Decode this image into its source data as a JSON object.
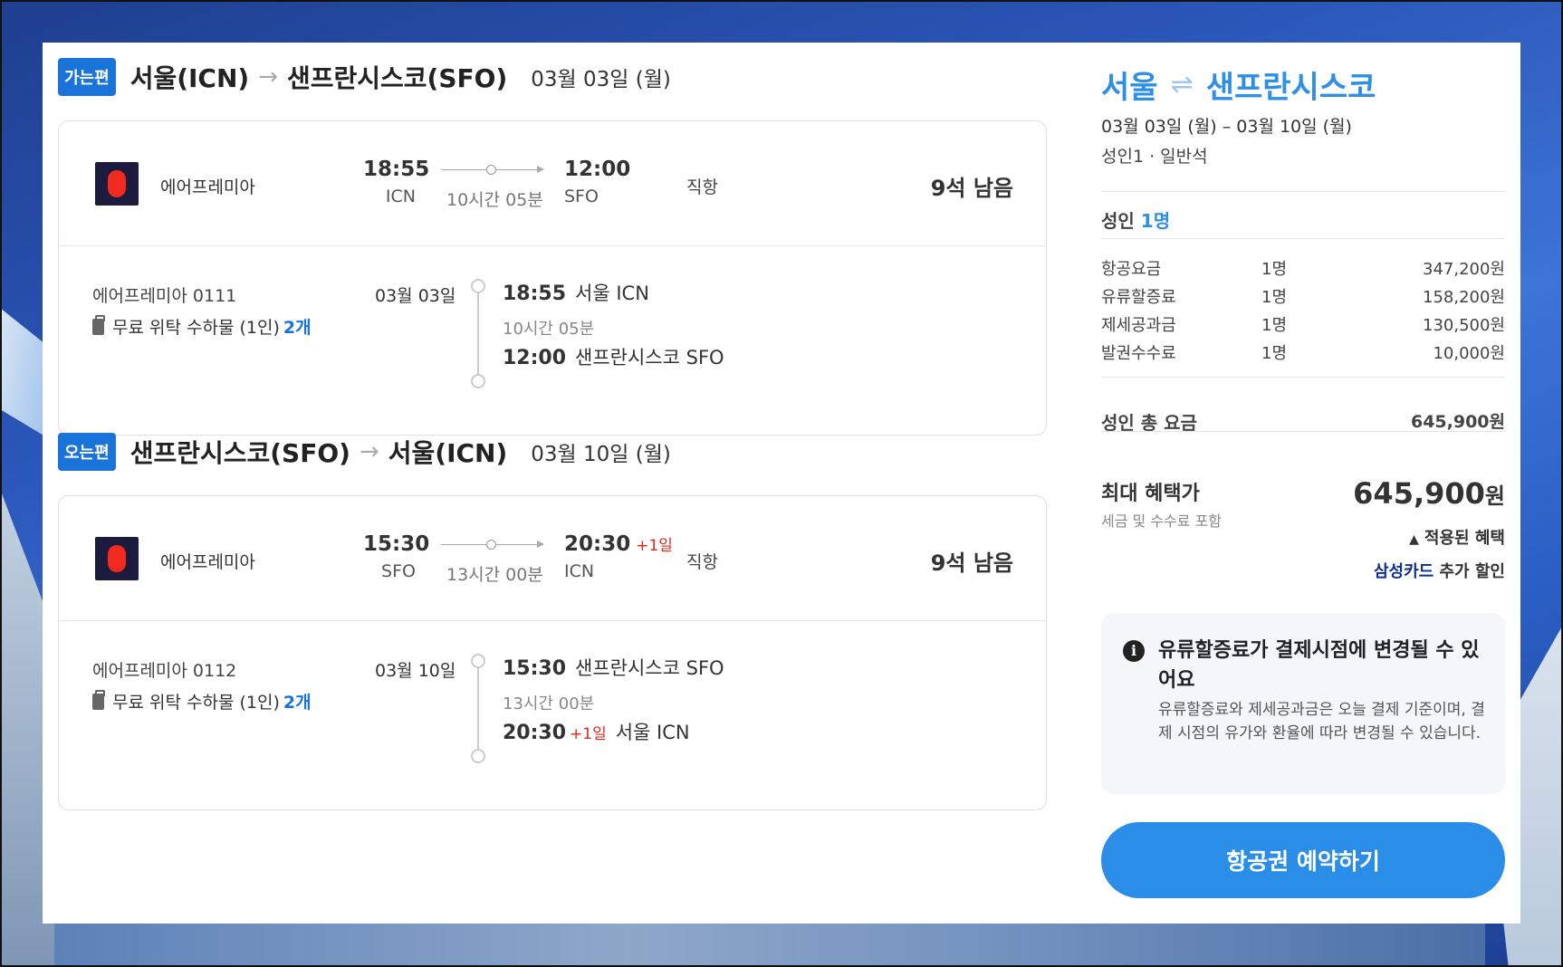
{
  "outbound": {
    "tag": "가는편",
    "from": "서울(ICN)",
    "to": "샌프란시스코(SFO)",
    "date": "03월 03일 (월)",
    "airline": "에어프레미아",
    "dep_time": "18:55",
    "dep_code": "ICN",
    "arr_time": "12:00",
    "arr_code": "SFO",
    "arr_plus": "",
    "duration": "10시간 05분",
    "direct": "직항",
    "seats": "9석 남음",
    "flight_no": "에어프레미아 0111",
    "baggage": "무료 위탁 수하물 (1인)",
    "baggage_count": "2개",
    "seg_date": "03월 03일",
    "seg_dep_time": "18:55",
    "seg_dep_place": "서울 ICN",
    "seg_duration": "10시간 05분",
    "seg_arr_time": "12:00",
    "seg_arr_plus": "",
    "seg_arr_place": "샌프란시스코 SFO"
  },
  "inbound": {
    "tag": "오는편",
    "from": "샌프란시스코(SFO)",
    "to": "서울(ICN)",
    "date": "03월 10일 (월)",
    "airline": "에어프레미아",
    "dep_time": "15:30",
    "dep_code": "SFO",
    "arr_time": "20:30",
    "arr_code": "ICN",
    "arr_plus": "+1일",
    "duration": "13시간 00분",
    "direct": "직항",
    "seats": "9석 남음",
    "flight_no": "에어프레미아 0112",
    "baggage": "무료 위탁 수하물 (1인)",
    "baggage_count": "2개",
    "seg_date": "03월 10일",
    "seg_dep_time": "15:30",
    "seg_dep_place": "샌프란시스코 SFO",
    "seg_duration": "13시간 00분",
    "seg_arr_time": "20:30",
    "seg_arr_plus": "+1일",
    "seg_arr_place": "서울 ICN"
  },
  "summary": {
    "origin": "서울",
    "destination": "샌프란시스코",
    "dates": "03월 03일 (월) – 03월 10일 (월)",
    "passengers": "성인1 · 일반석",
    "adult_label": "성인",
    "adult_count": "1명",
    "fees": [
      {
        "name": "항공요금",
        "qty": "1명",
        "value": "347,200원"
      },
      {
        "name": "유류할증료",
        "qty": "1명",
        "value": "158,200원"
      },
      {
        "name": "제세공과금",
        "qty": "1명",
        "value": "130,500원"
      },
      {
        "name": "발권수수료",
        "qty": "1명",
        "value": "10,000원"
      }
    ],
    "total_label": "성인 총 요금",
    "total_value": "645,900원",
    "best_label": "최대 혜택가",
    "best_sub": "세금 및 수수료 포함",
    "best_value": "645,900",
    "best_unit": "원",
    "applied_label": "적용된 혜택",
    "card_brand": "삼성카드",
    "card_discount": "추가 할인",
    "notice_title": "유류할증료가 결제시점에 변경될 수 있어요",
    "notice_body": "유류할증료와 제세공과금은 오늘 결제 기준이며, 결제 시점의 유가와 환율에 따라 변경될 수 있습니다.",
    "book_button": "항공권 예약하기"
  },
  "colors": {
    "accent": "#2d8fe6",
    "tag_blue": "#1a73d9",
    "red": "#e4281e",
    "logo_dark": "#1c1b3d",
    "logo_red": "#f02a1f"
  }
}
